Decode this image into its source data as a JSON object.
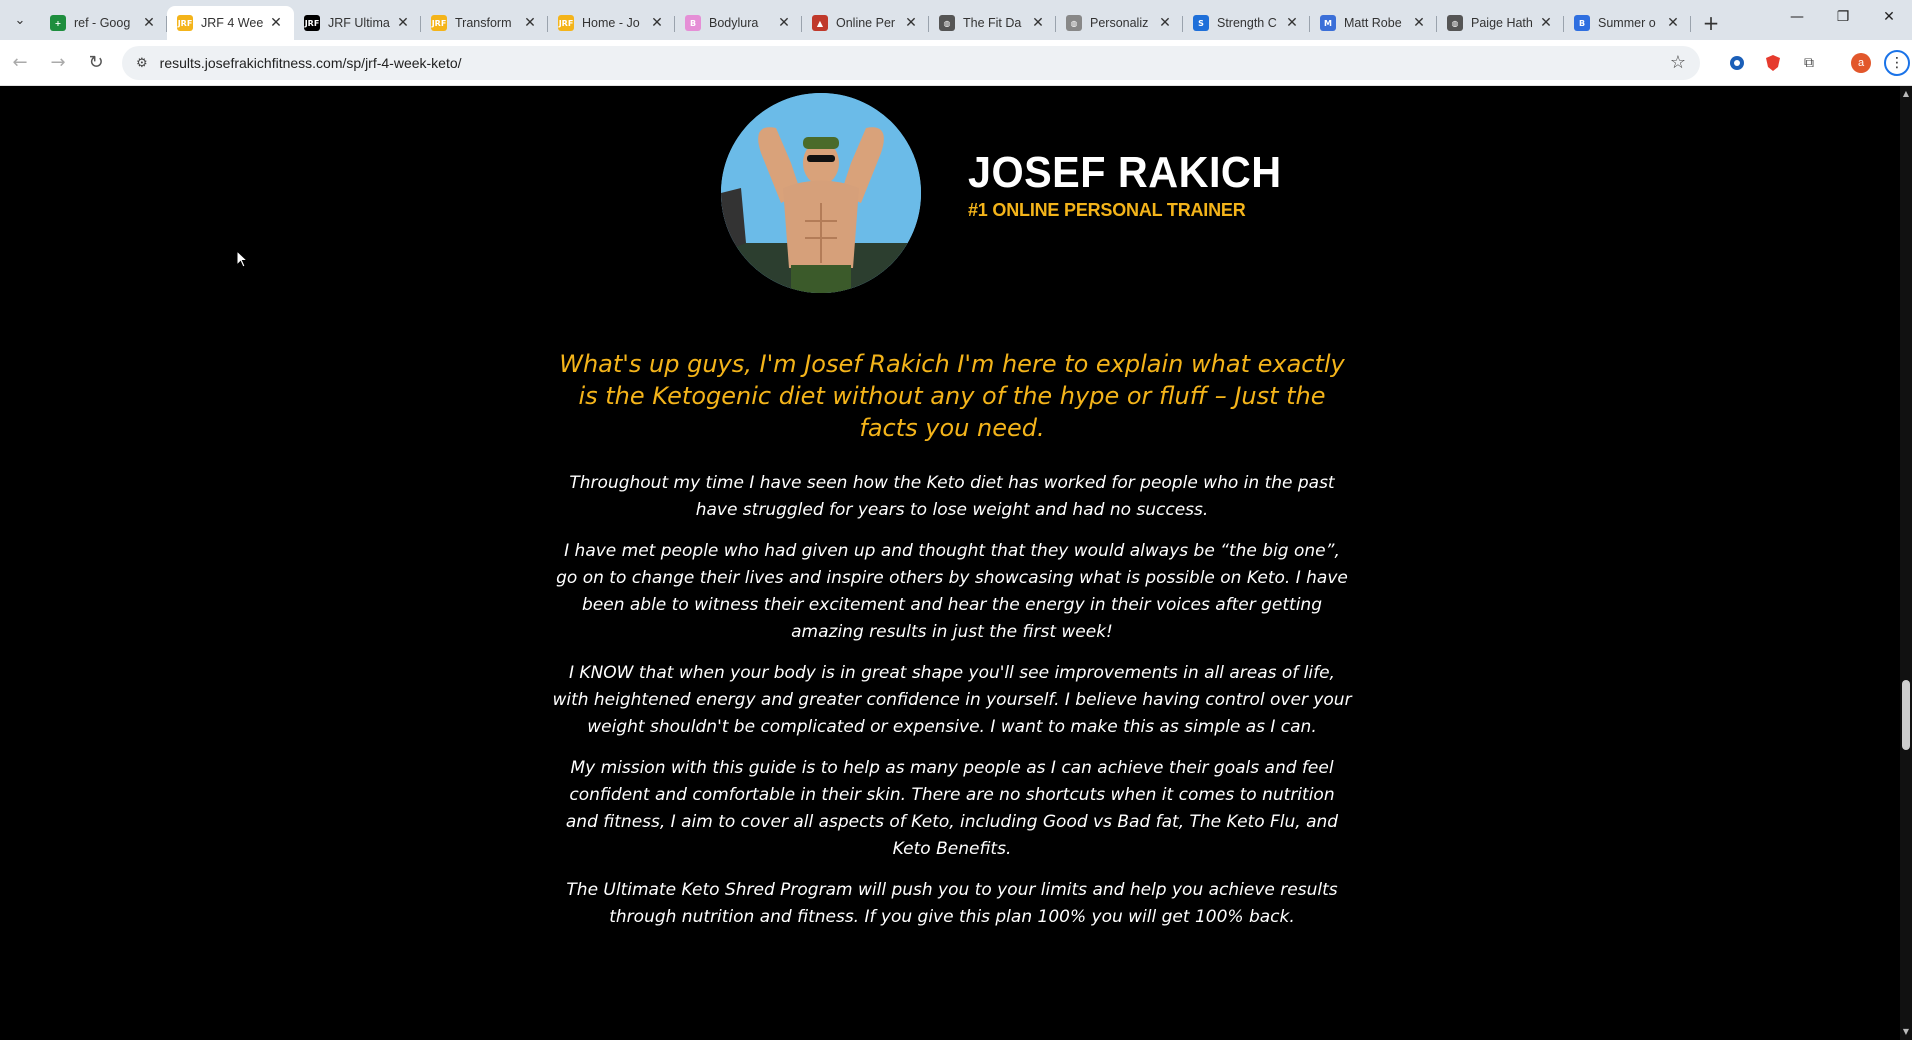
{
  "browser": {
    "tabs": [
      {
        "title": "ref - Goog",
        "icon": "sheets-icon",
        "color": "#1e8e3e",
        "glyph": "+"
      },
      {
        "title": "JRF 4 Wee",
        "icon": "jrf-icon",
        "color": "#f4b41a",
        "glyph": "JRF",
        "active": true
      },
      {
        "title": "JRF Ultima",
        "icon": "jrf-icon",
        "color": "#000000",
        "glyph": "JRF"
      },
      {
        "title": "Transform",
        "icon": "jrf-icon",
        "color": "#f4b41a",
        "glyph": "JRF"
      },
      {
        "title": "Home - Jo",
        "icon": "jrf-icon",
        "color": "#f4b41a",
        "glyph": "JRF"
      },
      {
        "title": "Bodylura",
        "icon": "bodylura-icon",
        "color": "#e58fd6",
        "glyph": "B"
      },
      {
        "title": "Online Per",
        "icon": "hat-icon",
        "color": "#c0392b",
        "glyph": "▲"
      },
      {
        "title": "The Fit Da",
        "icon": "globe-icon",
        "color": "#555555",
        "glyph": "◍"
      },
      {
        "title": "Personaliz",
        "icon": "globe-icon",
        "color": "#888888",
        "glyph": "◍"
      },
      {
        "title": "Strength C",
        "icon": "strength-icon",
        "color": "#1e6fd9",
        "glyph": "S"
      },
      {
        "title": "Matt Robe",
        "icon": "mr-icon",
        "color": "#3b6fd8",
        "glyph": "M"
      },
      {
        "title": "Paige Hath",
        "icon": "globe-icon",
        "color": "#555555",
        "glyph": "◍"
      },
      {
        "title": "Summer o",
        "icon": "summer-icon",
        "color": "#2f6fe0",
        "glyph": "B"
      }
    ],
    "url": "results.josefrakichfitness.com/sp/jrf-4-week-keto/",
    "profile_initial": "a"
  },
  "hero": {
    "name": "JOSEF RAKICH",
    "subtitle": "#1 ONLINE PERSONAL TRAINER"
  },
  "content": {
    "intro": "What's up guys, I'm Josef Rakich I'm here to explain what exactly is the Ketogenic diet without any of the hype or fluff – Just the facts you need.",
    "paragraphs": [
      "Throughout my time I have seen how the Keto diet has worked for people who in the past have struggled for years to lose weight and had no success.",
      "I have met people who had given up and thought that they would always be “the big one”, go on to change their lives and inspire others by showcasing what is possible on Keto. I have been able to witness their excitement and hear the energy in their voices after getting amazing results in just the first week!",
      "I KNOW that when your body is in great shape you'll see improvements in all areas of life, with heightened energy and greater confidence in yourself. I believe having control over your weight shouldn't be complicated or expensive. I want to make this as simple as I can.",
      "My mission with this guide is to help as many people as I can achieve their goals and feel confident and comfortable in their skin. There are no shortcuts when it comes to nutrition and fitness, I aim to cover all aspects of Keto, including Good vs Bad fat, The Keto Flu, and Keto Benefits.",
      "The Ultimate Keto Shred Program will push you to your limits and help you achieve results through nutrition and fitness. If you give this plan 100% you will get 100% back."
    ]
  },
  "colors": {
    "accent": "#f4b41a",
    "background": "#000000",
    "text": "#ffffff"
  }
}
